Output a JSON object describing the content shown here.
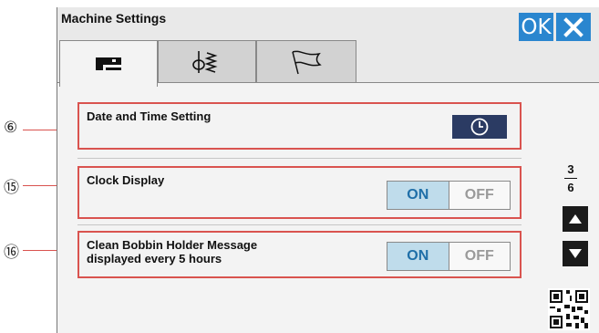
{
  "window": {
    "title": "Machine Settings",
    "ok_label": "OK"
  },
  "tabs": [
    {
      "icon": "sewing-machine-icon",
      "active": true
    },
    {
      "icon": "needle-thread-icon",
      "active": false
    },
    {
      "icon": "flag-icon",
      "active": false
    }
  ],
  "settings": [
    {
      "callout": "⑥",
      "label": "Date and Time Setting",
      "control": "clock-icon"
    },
    {
      "callout": "⑮",
      "label": "Clock Display",
      "on": "ON",
      "off": "OFF",
      "selected": "ON"
    },
    {
      "callout": "⑯",
      "label_line1": "Clean Bobbin Holder Message",
      "label_line2": "displayed every 5 hours",
      "on": "ON",
      "off": "OFF",
      "selected": "ON"
    }
  ],
  "pager": {
    "current": "3",
    "total": "6"
  },
  "colors": {
    "accent": "#2a86cf",
    "highlight": "#d9534f",
    "clock_button": "#2b3b63",
    "on_fill": "#bfdceb"
  }
}
